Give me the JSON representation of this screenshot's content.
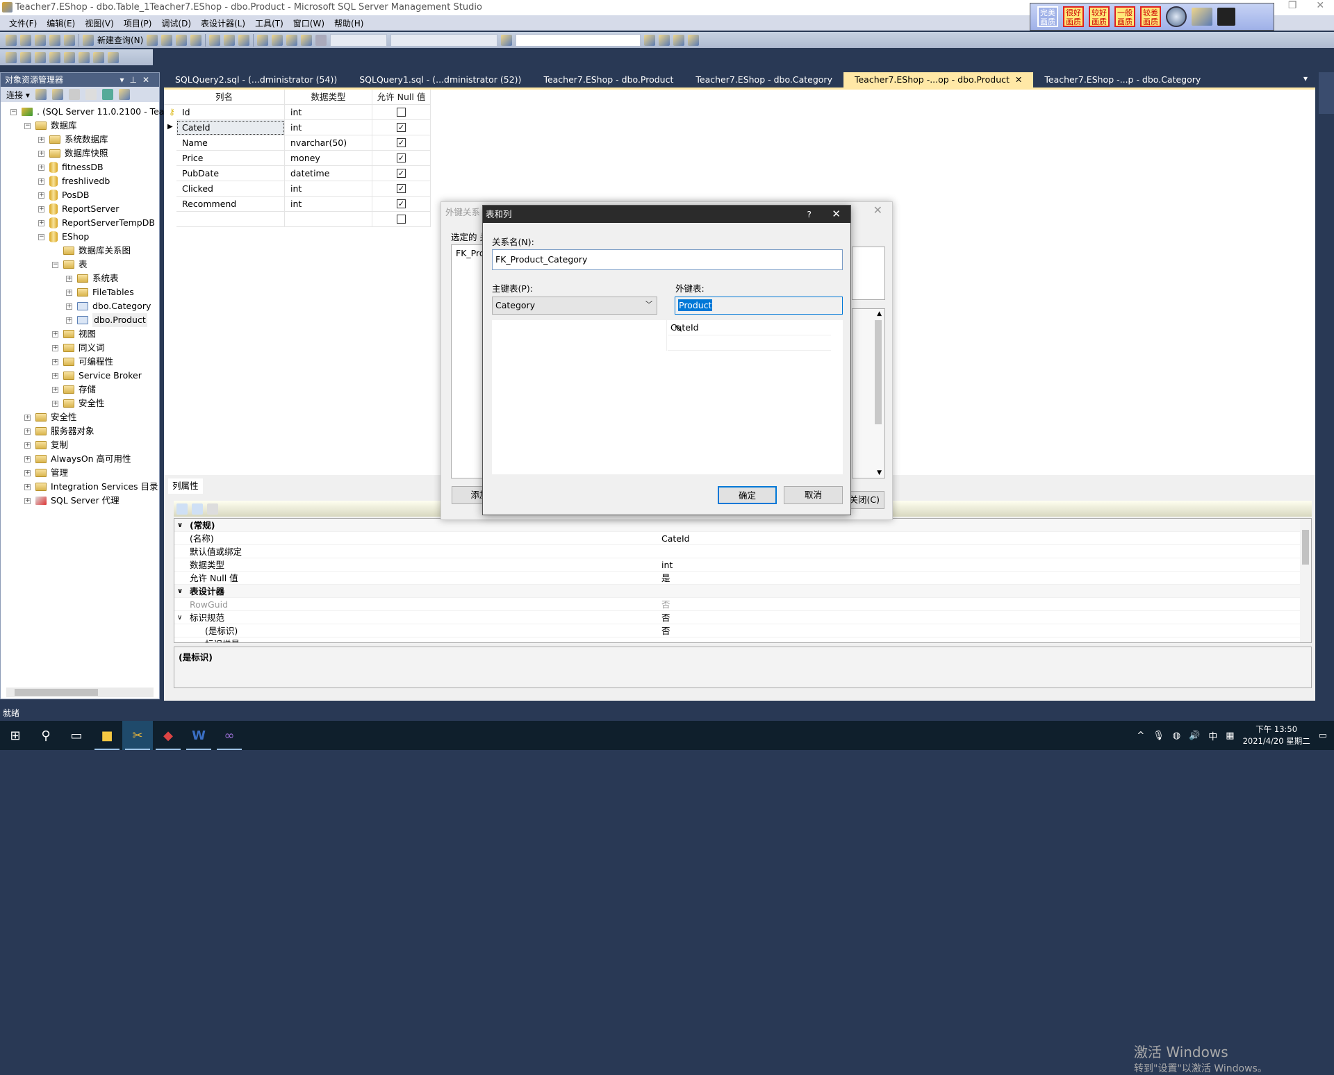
{
  "window": {
    "title": "Teacher7.EShop - dbo.Table_1Teacher7.EShop - dbo.Product - Microsoft SQL Server Management Studio"
  },
  "menu": [
    "文件(F)",
    "编辑(E)",
    "视图(V)",
    "项目(P)",
    "调试(D)",
    "表设计器(L)",
    "工具(T)",
    "窗口(W)",
    "帮助(H)"
  ],
  "toolbar": {
    "new_query": "新建查询(N)"
  },
  "quality_strip": [
    "完美画质",
    "很好画质",
    "较好画质",
    "一般画质",
    "较差画质"
  ],
  "explorer": {
    "title": "对象资源管理器",
    "connect": "连接",
    "tree": [
      {
        "label": ". (SQL Server 11.0.2100 - Teacl",
        "level": 0,
        "icon": "server",
        "state": "open"
      },
      {
        "label": "数据库",
        "level": 1,
        "icon": "folder",
        "state": "open"
      },
      {
        "label": "系统数据库",
        "level": 2,
        "icon": "folder",
        "state": "closed"
      },
      {
        "label": "数据库快照",
        "level": 2,
        "icon": "folder",
        "state": "closed"
      },
      {
        "label": "fitnessDB",
        "level": 2,
        "icon": "db",
        "state": "closed"
      },
      {
        "label": "freshlivedb",
        "level": 2,
        "icon": "db",
        "state": "closed"
      },
      {
        "label": "PosDB",
        "level": 2,
        "icon": "db",
        "state": "closed"
      },
      {
        "label": "ReportServer",
        "level": 2,
        "icon": "db",
        "state": "closed"
      },
      {
        "label": "ReportServerTempDB",
        "level": 2,
        "icon": "db",
        "state": "closed"
      },
      {
        "label": "EShop",
        "level": 2,
        "icon": "db",
        "state": "open"
      },
      {
        "label": "数据库关系图",
        "level": 3,
        "icon": "folder",
        "state": "none"
      },
      {
        "label": "表",
        "level": 3,
        "icon": "folder",
        "state": "open"
      },
      {
        "label": "系统表",
        "level": 4,
        "icon": "folder",
        "state": "closed"
      },
      {
        "label": "FileTables",
        "level": 4,
        "icon": "folder",
        "state": "closed"
      },
      {
        "label": "dbo.Category",
        "level": 4,
        "icon": "table",
        "state": "closed"
      },
      {
        "label": "dbo.Product",
        "level": 4,
        "icon": "table",
        "state": "closed",
        "selected": true
      },
      {
        "label": "视图",
        "level": 3,
        "icon": "folder",
        "state": "closed"
      },
      {
        "label": "同义词",
        "level": 3,
        "icon": "folder",
        "state": "closed"
      },
      {
        "label": "可编程性",
        "level": 3,
        "icon": "folder",
        "state": "closed"
      },
      {
        "label": "Service Broker",
        "level": 3,
        "icon": "folder",
        "state": "closed"
      },
      {
        "label": "存储",
        "level": 3,
        "icon": "folder",
        "state": "closed"
      },
      {
        "label": "安全性",
        "level": 3,
        "icon": "folder",
        "state": "closed"
      },
      {
        "label": "安全性",
        "level": 1,
        "icon": "folder",
        "state": "closed"
      },
      {
        "label": "服务器对象",
        "level": 1,
        "icon": "folder",
        "state": "closed"
      },
      {
        "label": "复制",
        "level": 1,
        "icon": "folder",
        "state": "closed"
      },
      {
        "label": "AlwaysOn 高可用性",
        "level": 1,
        "icon": "folder",
        "state": "closed"
      },
      {
        "label": "管理",
        "level": 1,
        "icon": "folder",
        "state": "closed"
      },
      {
        "label": "Integration Services 目录",
        "level": 1,
        "icon": "folder",
        "state": "closed"
      },
      {
        "label": "SQL Server 代理",
        "level": 1,
        "icon": "agent",
        "state": "closed"
      }
    ]
  },
  "tabs": [
    {
      "label": "SQLQuery2.sql - (...dministrator (54))"
    },
    {
      "label": "SQLQuery1.sql - (...dministrator (52))"
    },
    {
      "label": "Teacher7.EShop - dbo.Product"
    },
    {
      "label": "Teacher7.EShop - dbo.Category"
    },
    {
      "label": "Teacher7.EShop -...op - dbo.Product",
      "active": true
    },
    {
      "label": "Teacher7.EShop -...p - dbo.Category"
    }
  ],
  "grid": {
    "headers": [
      "列名",
      "数据类型",
      "允许 Null 值"
    ],
    "rows": [
      {
        "name": "Id",
        "type": "int",
        "nullable": false,
        "key": true
      },
      {
        "name": "CateId",
        "type": "int",
        "nullable": true,
        "current": true
      },
      {
        "name": "Name",
        "type": "nvarchar(50)",
        "nullable": true
      },
      {
        "name": "Price",
        "type": "money",
        "nullable": true
      },
      {
        "name": "PubDate",
        "type": "datetime",
        "nullable": true
      },
      {
        "name": "Clicked",
        "type": "int",
        "nullable": true
      },
      {
        "name": "Recommend",
        "type": "int",
        "nullable": true
      },
      {
        "name": "",
        "type": "",
        "nullable": false
      }
    ]
  },
  "properties": {
    "tab": "列属性",
    "rows": [
      {
        "key": "(常规)",
        "value": "",
        "category": true
      },
      {
        "key": "(名称)",
        "value": "CateId"
      },
      {
        "key": "默认值或绑定",
        "value": ""
      },
      {
        "key": "数据类型",
        "value": "int"
      },
      {
        "key": "允许 Null 值",
        "value": "是"
      },
      {
        "key": "表设计器",
        "value": "",
        "category": true
      },
      {
        "key": "RowGuid",
        "value": "否",
        "gray": true
      },
      {
        "key": "标识规范",
        "value": "否",
        "expandable": true
      },
      {
        "key": "(是标识)",
        "value": "否",
        "indent": true
      },
      {
        "key": "标识增量",
        "value": "",
        "indent": true
      }
    ],
    "description": "(是标识)"
  },
  "watermark": {
    "line1": "激活 Windows",
    "line2": "转到\"设置\"以激活 Windows。"
  },
  "fk_dialog": {
    "title": "外键关系",
    "selected_label": "选定的 关",
    "list_item": "FK_Pro",
    "add": "添加",
    "close": "关闭(C)"
  },
  "tc_dialog": {
    "title": "表和列",
    "help": "?",
    "relation_label": "关系名(N):",
    "relation_value": "FK_Product_Category",
    "pk_label": "主键表(P):",
    "pk_value": "Category",
    "fk_label": "外键表:",
    "fk_value": "Product",
    "fk_column": "CateId",
    "ok": "确定",
    "cancel": "取消"
  },
  "status": "就绪",
  "taskbar": {
    "time": "下午 13:50",
    "date": "2021/4/20 星期二",
    "ime": "中"
  },
  "colors": {
    "chrome": "#293955",
    "active_tab": "#ffe8a6",
    "selection": "#0078d7",
    "accent_button": "#0078d7"
  }
}
